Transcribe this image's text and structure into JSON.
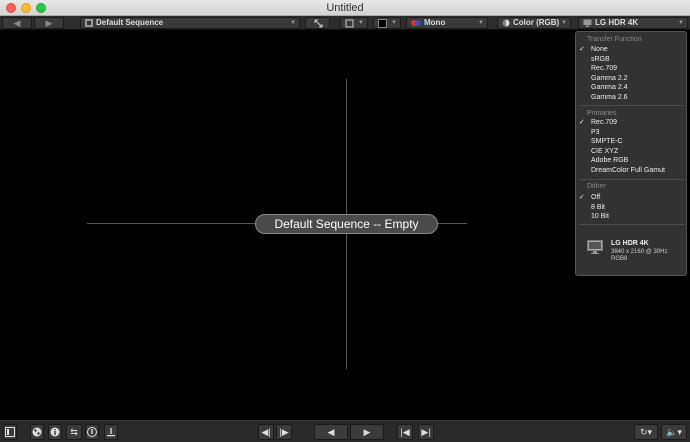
{
  "window": {
    "title": "Untitled"
  },
  "toolbar": {
    "sequence": "Default Sequence",
    "mono": "Mono",
    "color_mode": "Color (RGB)",
    "display": "LG HDR 4K"
  },
  "viewer": {
    "empty_label": "Default Sequence -- Empty"
  },
  "menu": {
    "transfer_heading": "Transfer Function",
    "transfer_items": [
      "None",
      "sRGB",
      "Rec.709",
      "Gamma 2.2",
      "Gamma 2.4",
      "Gamma 2.6"
    ],
    "transfer_selected": "None",
    "primaries_heading": "Primaries",
    "primaries_items": [
      "Rec.709",
      "P3",
      "SMPTE-C",
      "CIE XYZ",
      "Adobe RGB",
      "DreamColor Full Gamut"
    ],
    "primaries_selected": "Rec.709",
    "dither_heading": "Dither",
    "dither_items": [
      "Off",
      "8 Bit",
      "10 Bit"
    ],
    "dither_selected": "Off",
    "display_name": "LG HDR 4K",
    "display_resolution": "3840 x 2160 @ 30Hz",
    "display_format": "RGB8"
  }
}
